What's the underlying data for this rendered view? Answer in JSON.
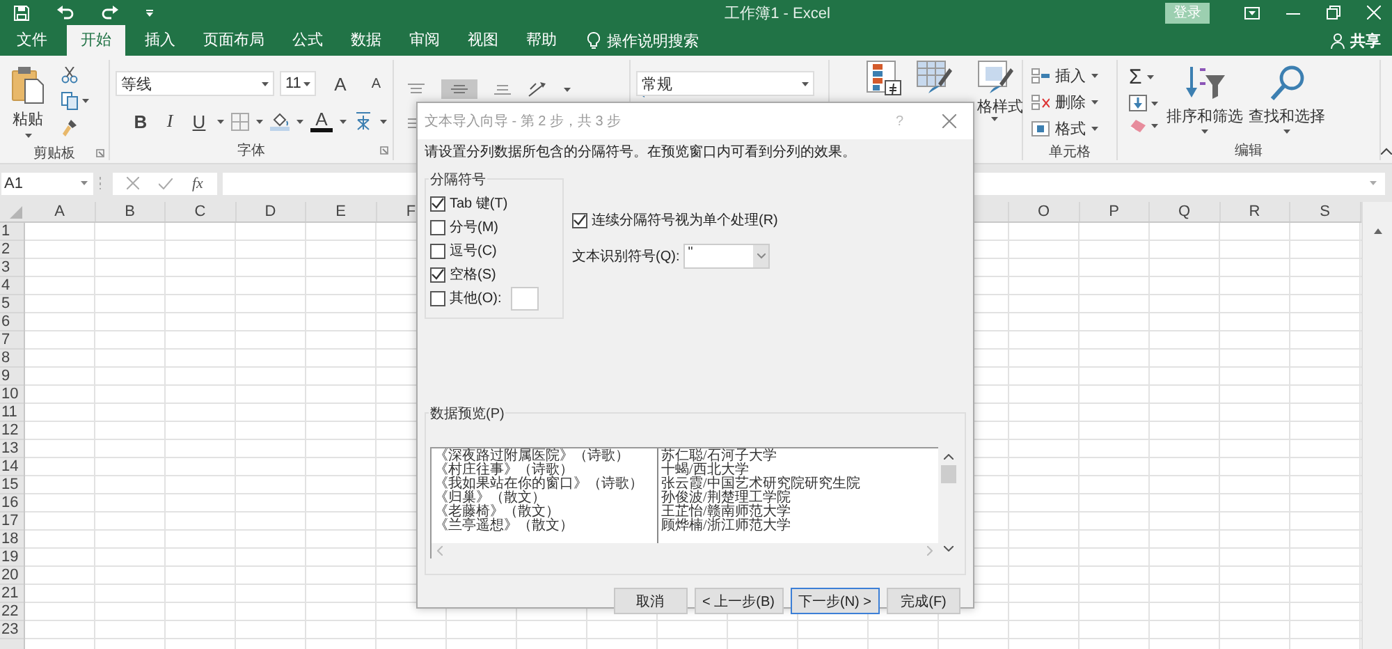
{
  "title_bar": {
    "title": "工作簿1 - Excel",
    "sign_in": "登录"
  },
  "tabs": [
    {
      "label": "文件",
      "selected": false
    },
    {
      "label": "开始",
      "selected": true
    },
    {
      "label": "插入",
      "selected": false
    },
    {
      "label": "页面布局",
      "selected": false
    },
    {
      "label": "公式",
      "selected": false
    },
    {
      "label": "数据",
      "selected": false
    },
    {
      "label": "审阅",
      "selected": false
    },
    {
      "label": "视图",
      "selected": false
    },
    {
      "label": "帮助",
      "selected": false
    }
  ],
  "tell_me": "操作说明搜索",
  "share": "共享",
  "ribbon": {
    "clipboard": {
      "paste": "粘贴",
      "label": "剪贴板"
    },
    "font": {
      "font_name": "等线",
      "font_size": "11",
      "grow": "A",
      "shrink": "A",
      "bold": "B",
      "italic": "I",
      "underline": "U",
      "font_color": "A",
      "label": "字体"
    },
    "number": {
      "format": "常规"
    },
    "styles": {
      "cell_styles": "格样式"
    },
    "cells": {
      "items": [
        "插入",
        "删除",
        "格式"
      ],
      "label": "单元格"
    },
    "editing": {
      "autosum": "Σ",
      "sort": "排序和筛选",
      "find": "查找和选择",
      "label": "编辑"
    }
  },
  "formula_bar": {
    "name_box": "A1",
    "insert_function": "fx"
  },
  "sheet": {
    "columns_left": [
      "A",
      "B",
      "C",
      "D",
      "E",
      "F"
    ],
    "columns_right": [
      "O",
      "P",
      "Q",
      "R",
      "S"
    ],
    "rows": [
      "1",
      "2",
      "3",
      "4",
      "5",
      "6",
      "7",
      "8",
      "9",
      "10",
      "11",
      "12",
      "13",
      "14",
      "15",
      "16",
      "17",
      "18",
      "19",
      "20",
      "21",
      "22",
      "23"
    ]
  },
  "dialog": {
    "title": "文本导入向导 - 第 2 步，共 3 步",
    "help": "?",
    "instruction": "请设置分列数据所包含的分隔符号。在预览窗口内可看到分列的效果。",
    "delimiters": {
      "legend": "分隔符号",
      "options": [
        {
          "label": "Tab 键(T)",
          "checked": true,
          "kind": "plain"
        },
        {
          "label": "分号(M)",
          "checked": false,
          "kind": "plain"
        },
        {
          "label": "逗号(C)",
          "checked": false,
          "kind": "plain"
        },
        {
          "label": "空格(S)",
          "checked": true,
          "kind": "plain"
        },
        {
          "label": "其他(O):",
          "checked": false,
          "kind": "other"
        }
      ]
    },
    "consecutive": {
      "label": "连续分隔符号视为单个处理(R)",
      "checked": true
    },
    "qualifier": {
      "label": "文本识别符号(Q):",
      "value": "\""
    },
    "preview": {
      "legend": "数据预览(P)",
      "rows": [
        [
          "《深夜路过附属医院》（诗歌）",
          "苏仁聪/石河子大学"
        ],
        [
          "《村庄往事》（诗歌）",
          "十蝎/西北大学"
        ],
        [
          "《我如果站在你的窗口》（诗歌）",
          "张云霞/中国艺术研究院研究生院"
        ],
        [
          "《归巢》（散文）",
          "孙俊波/荆楚理工学院"
        ],
        [
          "《老藤椅》（散文）",
          "王芷怡/赣南师范大学"
        ],
        [
          "《兰亭遥想》（散文）",
          "顾烨楠/浙江师范大学"
        ]
      ]
    },
    "buttons": [
      {
        "label": "取消",
        "default": false
      },
      {
        "label": "< 上一步(B)",
        "default": false
      },
      {
        "label": "下一步(N) >",
        "default": true
      },
      {
        "label": "完成(F)",
        "default": false
      }
    ]
  }
}
